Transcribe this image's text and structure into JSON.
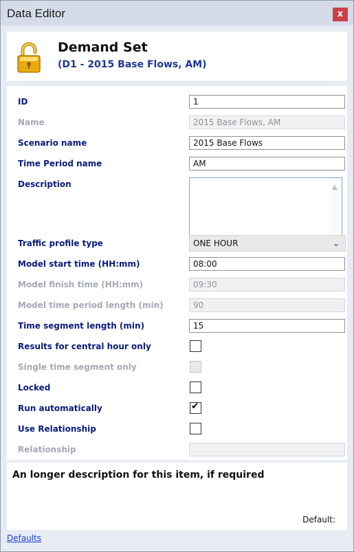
{
  "window": {
    "title": "Data Editor",
    "close_glyph": "x"
  },
  "header": {
    "icon": "lock-icon",
    "title": "Demand Set",
    "subtitle": "(D1 - 2015 Base Flows, AM)"
  },
  "fields": {
    "id": {
      "label": "ID",
      "value": "1"
    },
    "name": {
      "label": "Name",
      "value": "2015 Base Flows, AM"
    },
    "scenario_name": {
      "label": "Scenario name",
      "value": "2015 Base Flows"
    },
    "time_period_name": {
      "label": "Time Period name",
      "value": "AM"
    },
    "description": {
      "label": "Description",
      "value": ""
    },
    "traffic_profile_type": {
      "label": "Traffic profile type",
      "value": "ONE HOUR"
    },
    "model_start_time": {
      "label": "Model start time (HH:mm)",
      "value": "08:00"
    },
    "model_finish_time": {
      "label": "Model finish time (HH:mm)",
      "value": "09:30"
    },
    "model_time_period_length": {
      "label": "Model time period length (min)",
      "value": "90"
    },
    "time_segment_length": {
      "label": "Time segment length (min)",
      "value": "15"
    },
    "results_central_hour": {
      "label": "Results for central hour only",
      "checked": false
    },
    "single_time_segment": {
      "label": "Single time segment only",
      "checked": false
    },
    "locked": {
      "label": "Locked",
      "checked": false
    },
    "run_automatically": {
      "label": "Run automatically",
      "checked": true
    },
    "use_relationship": {
      "label": "Use Relationship",
      "checked": false
    },
    "relationship": {
      "label": "Relationship",
      "value": ""
    }
  },
  "description_panel": {
    "text": "An longer description for this item, if required",
    "default_label": "Default:"
  },
  "footer": {
    "defaults_link": "Defaults"
  },
  "colors": {
    "label_blue": "#0a1b7c",
    "disabled_gray": "#a4a9b3",
    "title_bar": "#d5dce8",
    "close_red": "#c9404a",
    "lock_gold": "#e8a90f"
  }
}
